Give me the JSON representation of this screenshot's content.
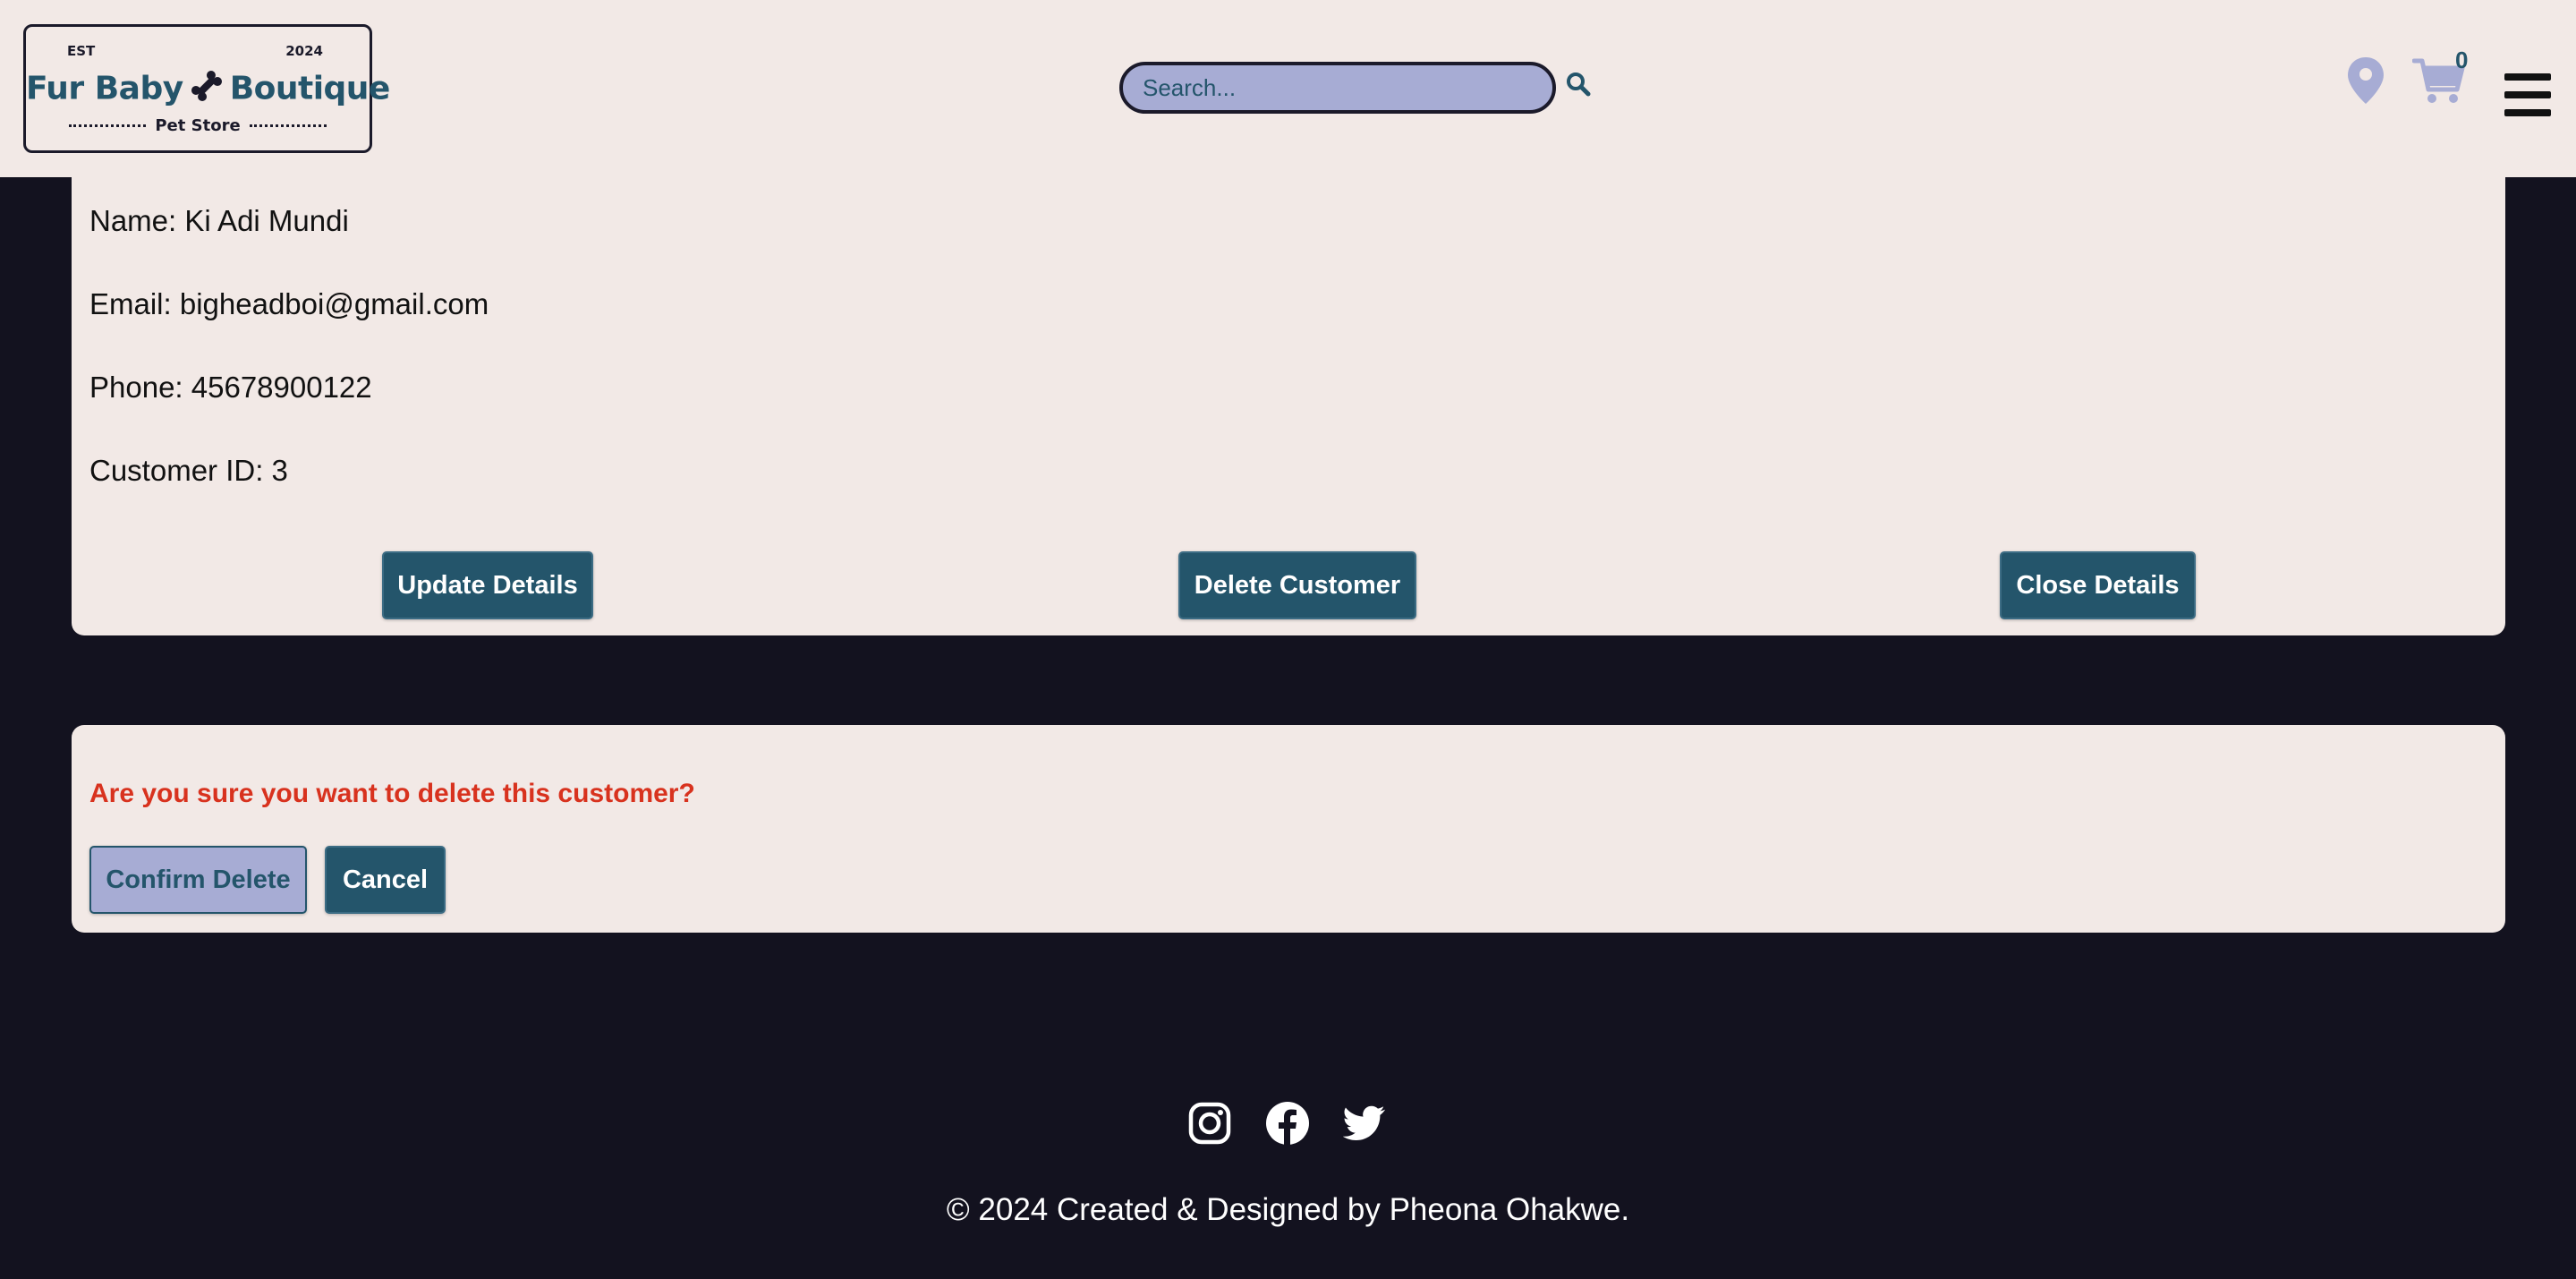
{
  "header": {
    "logo": {
      "est": "EST",
      "year": "2024",
      "brand_left": "Fur Baby",
      "brand_right": "Boutique",
      "subtitle": "Pet Store"
    },
    "search": {
      "placeholder": "Search..."
    },
    "icons": {
      "search": "search-icon",
      "location": "map-pin-icon",
      "cart": "cart-icon",
      "menu": "hamburger-menu-icon"
    },
    "cart_count": "0"
  },
  "details": {
    "name_line": "Name: Ki Adi Mundi",
    "email_line": "Email: bigheadboi@gmail.com",
    "phone_line": "Phone: 45678900122",
    "customer_id_line": "Customer ID: 3",
    "buttons": {
      "update": "Update Details",
      "delete": "Delete Customer",
      "close": "Close Details"
    }
  },
  "confirm": {
    "question": "Are you sure you want to delete this customer?",
    "confirm_label": "Confirm Delete",
    "cancel_label": "Cancel"
  },
  "footer": {
    "social": [
      "instagram-icon",
      "facebook-icon",
      "twitter-icon"
    ],
    "copyright": "© 2024 Created & Designed by Pheona Ohakwe."
  },
  "colors": {
    "panel_bg": "#f2e9e6",
    "page_bg": "#13121f",
    "button_primary": "#24556b",
    "button_secondary": "#a7acd4",
    "warning_text": "#d8321e",
    "icon_lavender": "#a7acd4"
  }
}
